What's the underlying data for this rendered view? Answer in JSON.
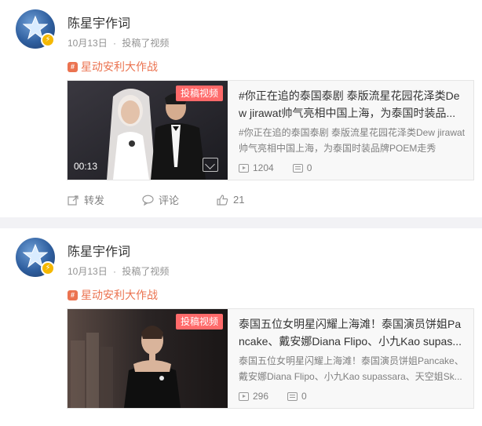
{
  "posts": [
    {
      "username": "陈星宇作词",
      "date": "10月13日",
      "separator": "·",
      "action_text": "投稿了视频",
      "topic": "星动安利大作战",
      "topic_icon": "topic-icon",
      "tag": "投稿视频",
      "duration": "00:13",
      "title": "#你正在追的泰国泰剧 泰版流星花园花泽类Dew jirawat帅气亮相中国上海，为泰国时装品...",
      "desc": "#你正在追的泰国泰剧 泰版流星花园花泽类Dew jirawat帅气亮相中国上海，为泰国时装品牌POEM走秀",
      "plays": "1204",
      "comments": "0",
      "actions": {
        "repost": "转发",
        "comment": "评论",
        "like": "21"
      }
    },
    {
      "username": "陈星宇作词",
      "date": "10月13日",
      "separator": "·",
      "action_text": "投稿了视频",
      "topic": "星动安利大作战",
      "topic_icon": "topic-icon",
      "tag": "投稿视频",
      "title": "泰国五位女明星闪耀上海滩！泰国演员饼姐Pancake、戴安娜Diana Flipo、小九Kao supas...",
      "desc": "泰国五位女明星闪耀上海滩！泰国演员饼姐Pancake、戴安娜Diana Flipo、小九Kao supassara、天空姐Sk...",
      "plays": "296",
      "comments": "0"
    }
  ],
  "colors": {
    "topic": "#eb7350",
    "tag": "#ff6a6a",
    "badge": "#f5b800"
  }
}
